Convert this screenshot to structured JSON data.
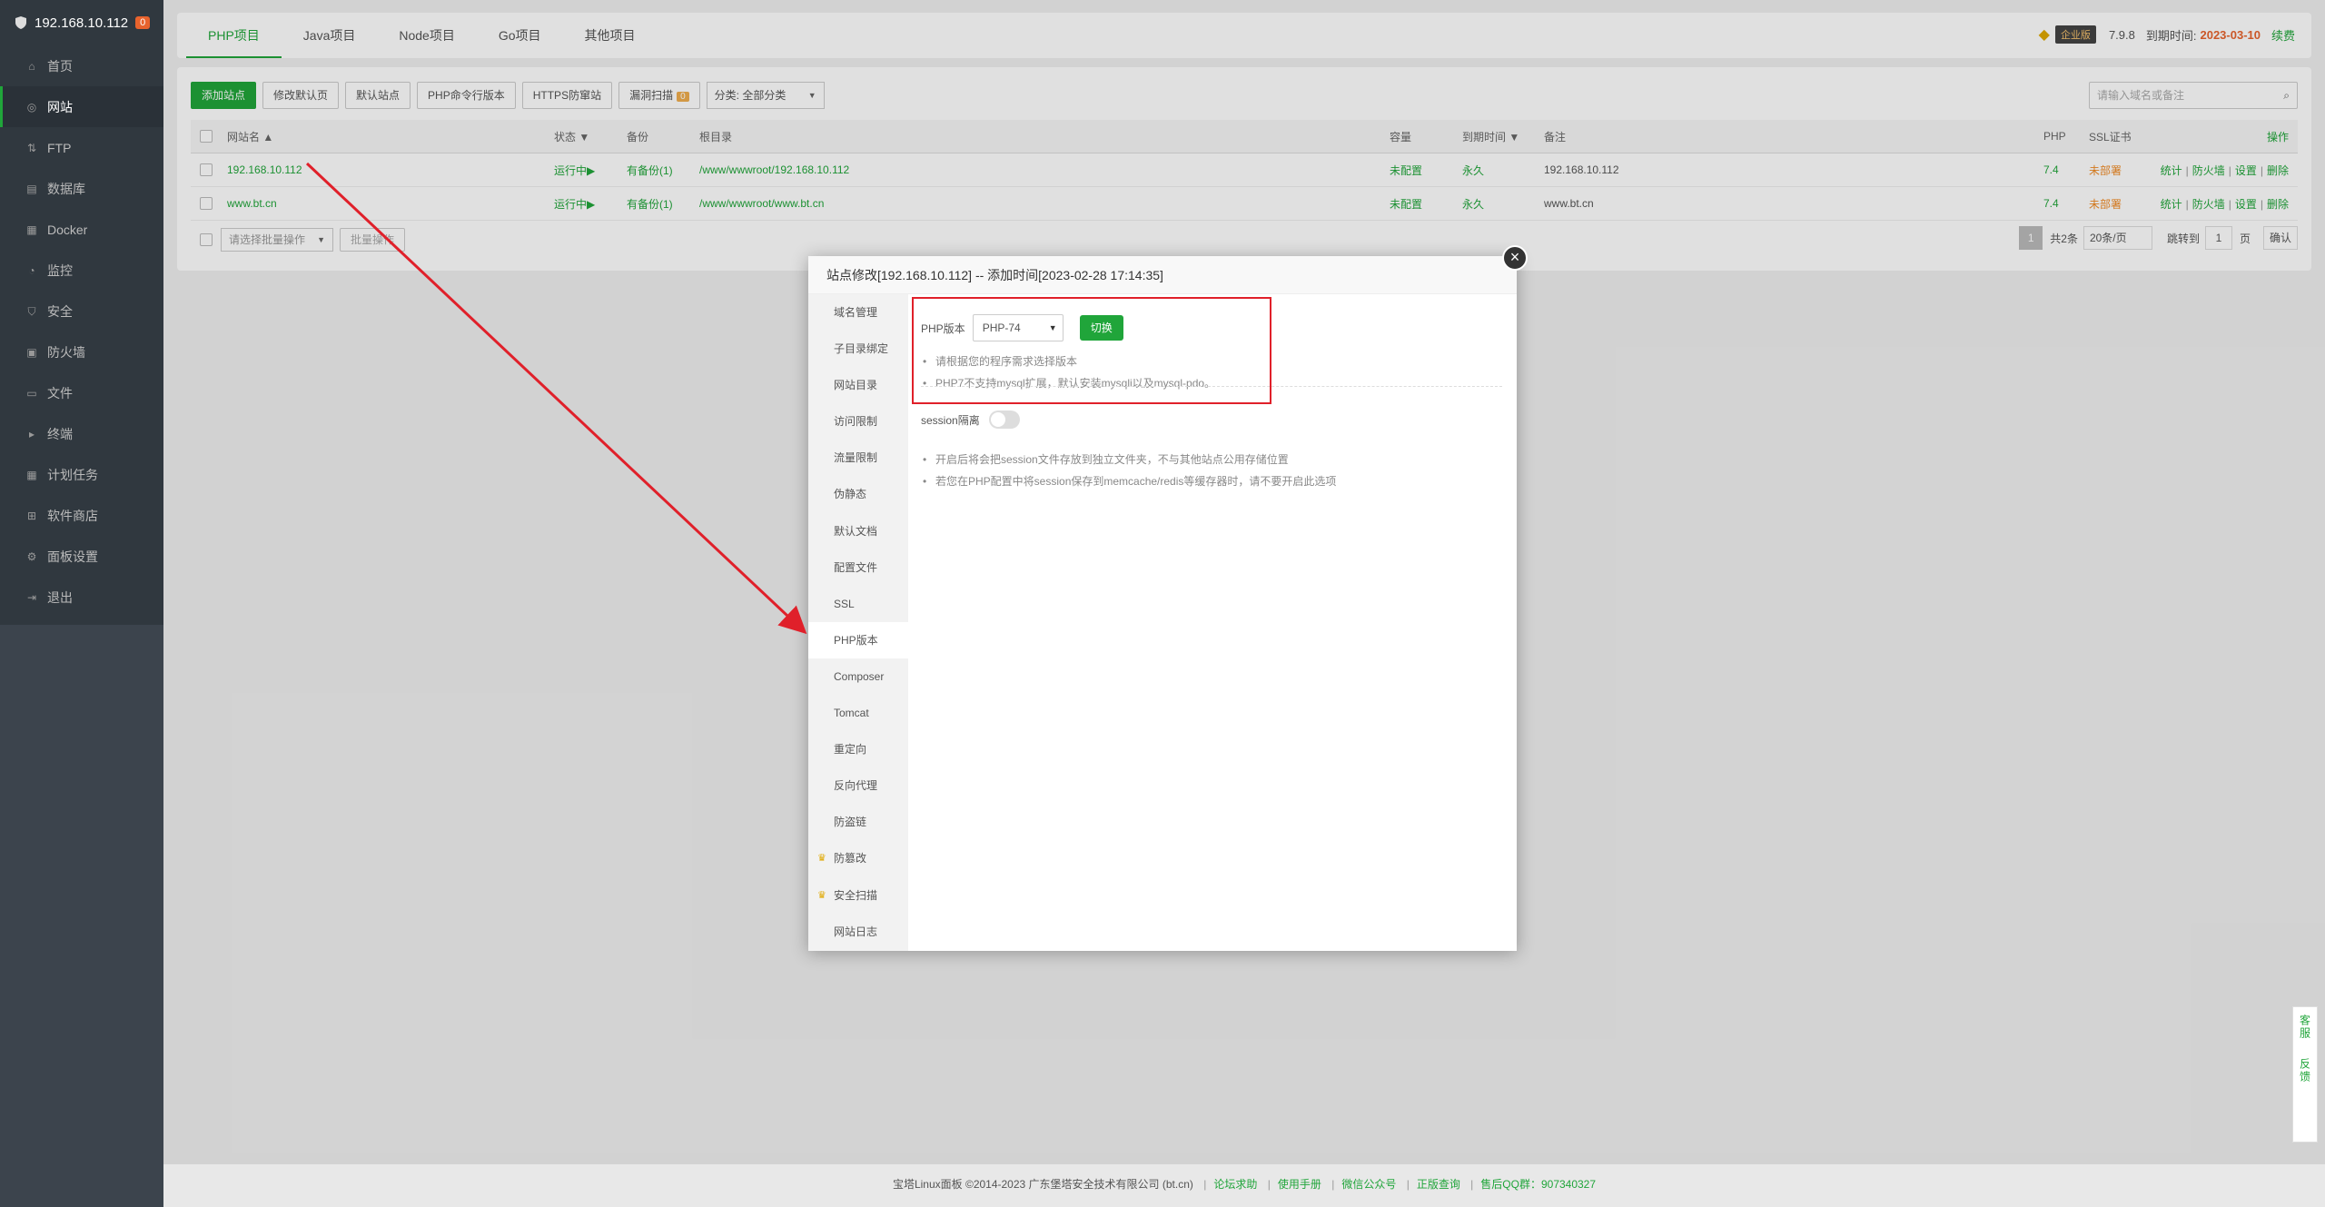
{
  "sidebar": {
    "host": "192.168.10.112",
    "badge": "0",
    "items": [
      {
        "label": "首页",
        "icon": "home-icon"
      },
      {
        "label": "网站",
        "icon": "globe-icon"
      },
      {
        "label": "FTP",
        "icon": "ftp-icon"
      },
      {
        "label": "数据库",
        "icon": "database-icon"
      },
      {
        "label": "Docker",
        "icon": "docker-icon"
      },
      {
        "label": "监控",
        "icon": "monitor-icon"
      },
      {
        "label": "安全",
        "icon": "shield-icon"
      },
      {
        "label": "防火墙",
        "icon": "firewall-icon"
      },
      {
        "label": "文件",
        "icon": "folder-icon"
      },
      {
        "label": "终端",
        "icon": "terminal-icon"
      },
      {
        "label": "计划任务",
        "icon": "calendar-icon"
      },
      {
        "label": "软件商店",
        "icon": "grid-icon"
      },
      {
        "label": "面板设置",
        "icon": "settings-icon"
      },
      {
        "label": "退出",
        "icon": "logout-icon"
      }
    ]
  },
  "tabs": [
    "PHP项目",
    "Java项目",
    "Node项目",
    "Go项目",
    "其他项目"
  ],
  "topright": {
    "edition": "企业版",
    "version": "7.9.8",
    "expire_label": "到期时间:",
    "expire_date": "2023-03-10",
    "renew": "续费"
  },
  "toolbar": {
    "add_site": "添加站点",
    "modify_default": "修改默认页",
    "default_site": "默认站点",
    "php_cli": "PHP命令行版本",
    "https_defense": "HTTPS防窜站",
    "vuln_scan": "漏洞扫描",
    "vuln_count": "0",
    "category": "分类: 全部分类",
    "search_placeholder": "请输入域名或备注"
  },
  "table": {
    "headers": {
      "name": "网站名 ▲",
      "status": "状态 ▼",
      "backup": "备份",
      "root": "根目录",
      "capacity": "容量",
      "expire": "到期时间 ▼",
      "remark": "备注",
      "php": "PHP",
      "ssl": "SSL证书",
      "ops": "操作"
    },
    "rows": [
      {
        "name": "192.168.10.112",
        "status": "运行中▶",
        "backup": "有备份(1)",
        "root": "/www/wwwroot/192.168.10.112",
        "capacity": "未配置",
        "expire": "永久",
        "remark": "192.168.10.112",
        "php": "7.4",
        "ssl": "未部署"
      },
      {
        "name": "www.bt.cn",
        "status": "运行中▶",
        "backup": "有备份(1)",
        "root": "/www/wwwroot/www.bt.cn",
        "capacity": "未配置",
        "expire": "永久",
        "remark": "www.bt.cn",
        "php": "7.4",
        "ssl": "未部署"
      }
    ],
    "ops": {
      "stats": "统计",
      "firewall": "防火墙",
      "settings": "设置",
      "delete": "删除"
    },
    "batch_select": "请选择批量操作",
    "batch_btn": "批量操作"
  },
  "pager": {
    "current": "1",
    "total": "共2条",
    "per_page": "20条/页",
    "jump_label": "跳转到",
    "jump_value": "1",
    "page_unit": "页",
    "confirm": "确认"
  },
  "dialog": {
    "title": "站点修改[192.168.10.112] -- 添加时间[2023-02-28 17:14:35]",
    "close": "×",
    "nav": [
      {
        "label": "域名管理",
        "crown": false
      },
      {
        "label": "子目录绑定",
        "crown": false
      },
      {
        "label": "网站目录",
        "crown": false
      },
      {
        "label": "访问限制",
        "crown": false
      },
      {
        "label": "流量限制",
        "crown": false
      },
      {
        "label": "伪静态",
        "crown": false
      },
      {
        "label": "默认文档",
        "crown": false
      },
      {
        "label": "配置文件",
        "crown": false
      },
      {
        "label": "SSL",
        "crown": false
      },
      {
        "label": "PHP版本",
        "crown": false
      },
      {
        "label": "Composer",
        "crown": false
      },
      {
        "label": "Tomcat",
        "crown": false
      },
      {
        "label": "重定向",
        "crown": false
      },
      {
        "label": "反向代理",
        "crown": false
      },
      {
        "label": "防盗链",
        "crown": false
      },
      {
        "label": "防篡改",
        "crown": true
      },
      {
        "label": "安全扫描",
        "crown": true
      },
      {
        "label": "网站日志",
        "crown": false
      }
    ],
    "php_label": "PHP版本",
    "php_value": "PHP-74",
    "switch_label": "切换",
    "php_tips": [
      "请根据您的程序需求选择版本",
      "PHP7不支持mysql扩展，默认安装mysqli以及mysql-pdo。"
    ],
    "session_label": "session隔离",
    "session_tips": [
      "开启后将会把session文件存放到独立文件夹，不与其他站点公用存储位置",
      "若您在PHP配置中将session保存到memcache/redis等缓存器时，请不要开启此选项"
    ]
  },
  "footer": {
    "copy": "宝塔Linux面板 ©2014-2023 广东堡塔安全技术有限公司 (bt.cn)",
    "links": [
      "论坛求助",
      "使用手册",
      "微信公众号",
      "正版查询"
    ],
    "qq": "售后QQ群：907340327"
  },
  "side_float": [
    "客服",
    "反馈"
  ]
}
